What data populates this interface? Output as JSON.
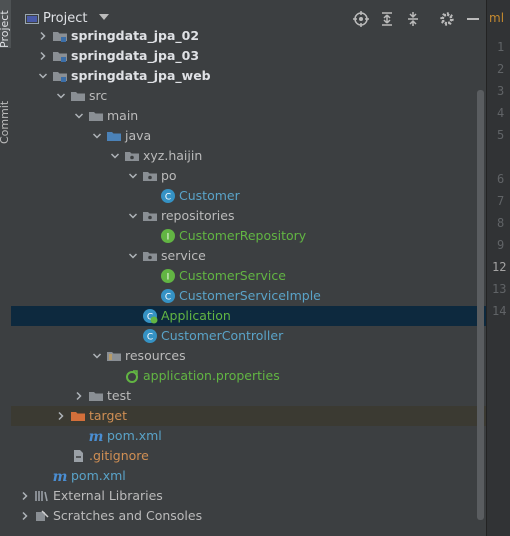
{
  "strip": {
    "project_tab": "Project",
    "commit_tab": "Commit"
  },
  "header": {
    "title": "Project",
    "toolbar_icons": [
      "locate-icon",
      "expand-all-icon",
      "collapse-all-icon",
      "settings-icon",
      "hide-icon"
    ]
  },
  "tree": [
    {
      "label": "springdata_jpa_02",
      "style": "bold",
      "indent": 0,
      "arrow": "right",
      "icon": "module-folder-icon"
    },
    {
      "label": "springdata_jpa_03",
      "style": "bold",
      "indent": 0,
      "arrow": "right",
      "icon": "module-folder-icon"
    },
    {
      "label": "springdata_jpa_web",
      "style": "bold",
      "indent": 0,
      "arrow": "down",
      "icon": "module-folder-icon"
    },
    {
      "label": "src",
      "style": "plain",
      "indent": 1,
      "arrow": "down",
      "icon": "folder-icon"
    },
    {
      "label": "main",
      "style": "plain",
      "indent": 2,
      "arrow": "down",
      "icon": "folder-icon"
    },
    {
      "label": "java",
      "style": "plain",
      "indent": 3,
      "arrow": "down",
      "icon": "source-folder-icon"
    },
    {
      "label": "xyz.haijin",
      "style": "plain",
      "indent": 4,
      "arrow": "down",
      "icon": "package-icon"
    },
    {
      "label": "po",
      "style": "plain",
      "indent": 5,
      "arrow": "down",
      "icon": "package-icon"
    },
    {
      "label": "Customer",
      "style": "cls",
      "indent": 6,
      "arrow": "none",
      "icon": "class-icon"
    },
    {
      "label": "repositories",
      "style": "plain",
      "indent": 5,
      "arrow": "down",
      "icon": "package-icon"
    },
    {
      "label": "CustomerRepository",
      "style": "grn",
      "indent": 6,
      "arrow": "none",
      "icon": "interface-icon"
    },
    {
      "label": "service",
      "style": "plain",
      "indent": 5,
      "arrow": "down",
      "icon": "package-icon"
    },
    {
      "label": "CustomerService",
      "style": "grn",
      "indent": 6,
      "arrow": "none",
      "icon": "interface-icon"
    },
    {
      "label": "CustomerServiceImple",
      "style": "cls",
      "indent": 6,
      "arrow": "none",
      "icon": "class-icon"
    },
    {
      "label": "Application",
      "style": "grn",
      "indent": 5,
      "arrow": "none",
      "icon": "spring-class-icon",
      "selected": true
    },
    {
      "label": "CustomerController",
      "style": "cls",
      "indent": 5,
      "arrow": "none",
      "icon": "class-icon"
    },
    {
      "label": "resources",
      "style": "plain",
      "indent": 3,
      "arrow": "down",
      "icon": "resources-folder-icon"
    },
    {
      "label": "application.properties",
      "style": "grn",
      "indent": 4,
      "arrow": "none",
      "icon": "spring-properties-icon"
    },
    {
      "label": "test",
      "style": "plain",
      "indent": 2,
      "arrow": "right",
      "icon": "folder-icon"
    },
    {
      "label": "target",
      "style": "org",
      "indent": 1,
      "arrow": "right",
      "icon": "excluded-folder-icon",
      "ignored": true
    },
    {
      "label": "pom.xml",
      "style": "cls",
      "indent": 2,
      "arrow": "none",
      "icon": "maven-icon"
    },
    {
      "label": ".gitignore",
      "style": "org",
      "indent": 1,
      "arrow": "none",
      "icon": "gitignore-icon"
    },
    {
      "label": "pom.xml",
      "style": "cls",
      "indent": 0,
      "arrow": "none",
      "icon": "maven-icon",
      "noarrowcol": true
    },
    {
      "label": "External Libraries",
      "style": "plain",
      "indent": -1,
      "arrow": "right",
      "icon": "libraries-icon"
    },
    {
      "label": "Scratches and Consoles",
      "style": "plain",
      "indent": -1,
      "arrow": "right",
      "icon": "scratches-icon"
    }
  ],
  "editor": {
    "tab_text": "ml",
    "line_numbers": [
      "1",
      "2",
      "3",
      "4",
      "5",
      "6",
      "7",
      "8",
      "9",
      "12",
      "13",
      "14"
    ],
    "current_line": "12"
  }
}
